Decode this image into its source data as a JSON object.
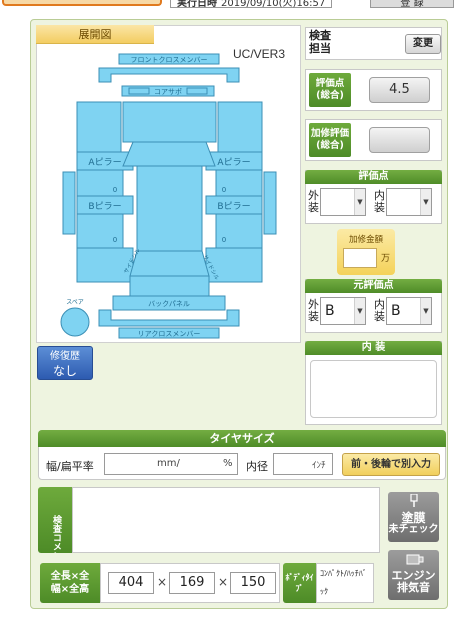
{
  "top": {
    "date_label": "実行日時",
    "date_value": "2019/09/10(火)16:57",
    "register_button": "登 録"
  },
  "diagram": {
    "tab_label": "展開図",
    "model_code": "UC/VER3",
    "parts": {
      "front_cross_member": "フロントクロスメンバー",
      "core_support": "コアサポ",
      "a_pillar_left": "Aピラー",
      "a_pillar_right": "Aピラー",
      "b_pillar_left": "Bピラー",
      "b_pillar_right": "Bピラー",
      "side_sill_left": "サイドシル",
      "side_sill_right": "サイドシル",
      "back_panel": "バックパネル",
      "rear_cross_member": "リアクロスメンバー",
      "spare": "スペア",
      "marker_left_upper": "0",
      "marker_left_lower": "0",
      "marker_right_upper": "0",
      "marker_right_lower": "0"
    }
  },
  "inspection": {
    "label": "検査担当",
    "change_button": "変更"
  },
  "score": {
    "overall_label": "評価点(総合)",
    "overall_value": "4.5",
    "repair_eval_label": "加修評価(総合)",
    "repair_eval_value": ""
  },
  "eval_points": {
    "header": "評価点",
    "exterior_label": "外装",
    "exterior_value": "",
    "interior_label": "内装",
    "interior_value": ""
  },
  "repair_amount": {
    "label": "加修金額",
    "value": "",
    "unit": "万"
  },
  "original_eval": {
    "header": "元評価点",
    "exterior_label": "外装",
    "exterior_value": "B",
    "interior_label": "内装",
    "interior_value": "B"
  },
  "repair_history": {
    "line1": "修復歴",
    "line2": "なし"
  },
  "interior": {
    "header": "内 装",
    "value": ""
  },
  "tire": {
    "header": "タイヤサイズ",
    "width_label": "幅/扁平率",
    "width_unit": "mm/",
    "ratio_unit": "%",
    "inner_label": "内径",
    "inner_unit": "ｲﾝﾁ",
    "front_rear_button": "前・後輪で別入力"
  },
  "comment": {
    "label": "検査コメント",
    "value": ""
  },
  "buttons": {
    "paint_line1": "塗膜",
    "paint_line2": "未チェック",
    "engine_line1": "エンジン",
    "engine_line2": "排気音"
  },
  "dimensions": {
    "label": "全長×全幅×全高",
    "length": "404",
    "width": "169",
    "height": "150",
    "separator": "×"
  },
  "body_type": {
    "label": "ﾎﾞﾃﾞｨﾀｲﾌﾟ",
    "value": "ｺﾝﾊﾟｸﾄ/ﾊｯﾁﾊﾞｯｸ"
  },
  "colors": {
    "panel_green": "#4f8c28",
    "part_blue": "#7fd3f2",
    "part_stroke": "#3b8fb5",
    "accent_orange": "#e07a1f"
  }
}
